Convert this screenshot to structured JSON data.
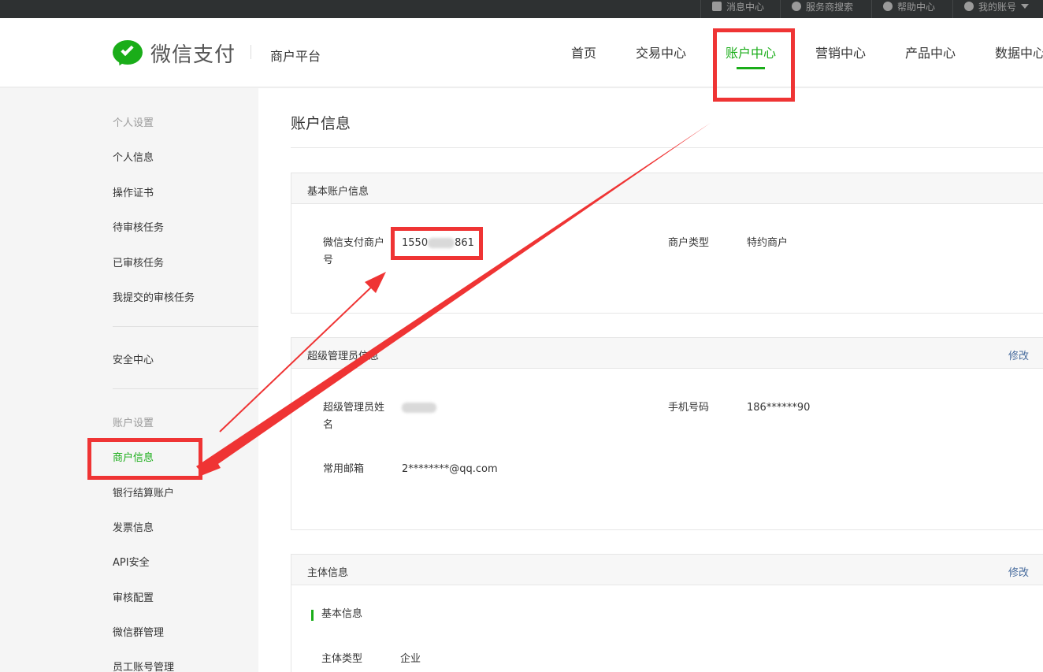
{
  "topbar": {
    "links": [
      "消息中心",
      "服务商搜索",
      "帮助中心",
      "我的账号"
    ]
  },
  "header": {
    "brand": "微信支付",
    "platform": "商户平台",
    "nav": [
      "首页",
      "交易中心",
      "账户中心",
      "营销中心",
      "产品中心",
      "数据中心"
    ],
    "active_nav": "账户中心"
  },
  "sidebar": {
    "group_personal": "个人设置",
    "personal_items": [
      "个人信息",
      "操作证书",
      "待审核任务",
      "已审核任务",
      "我提交的审核任务"
    ],
    "security": "安全中心",
    "group_account": "账户设置",
    "account_items": [
      "商户信息",
      "银行结算账户",
      "发票信息",
      "API安全",
      "审核配置",
      "微信群管理",
      "员工账号管理"
    ],
    "active_item": "商户信息"
  },
  "main": {
    "title": "账户信息",
    "basic": {
      "header": "基本账户信息",
      "merchant_id_label": "微信支付商户号",
      "merchant_id_prefix": "1550",
      "merchant_id_suffix": "861",
      "type_label": "商户类型",
      "type_value": "特约商户"
    },
    "admin": {
      "header": "超级管理员信息",
      "edit": "修改",
      "name_label": "超级管理员姓名",
      "phone_label": "手机号码",
      "phone_value": "186******90",
      "email_label": "常用邮箱",
      "email_value": "2********@qq.com"
    },
    "entity": {
      "header": "主体信息",
      "edit": "修改",
      "subheader": "基本信息",
      "type_label": "主体类型",
      "type_value": "企业"
    }
  },
  "colors": {
    "brand_green": "#1aad19",
    "annotation_red": "#ef3434",
    "link_blue": "#496d9e"
  }
}
